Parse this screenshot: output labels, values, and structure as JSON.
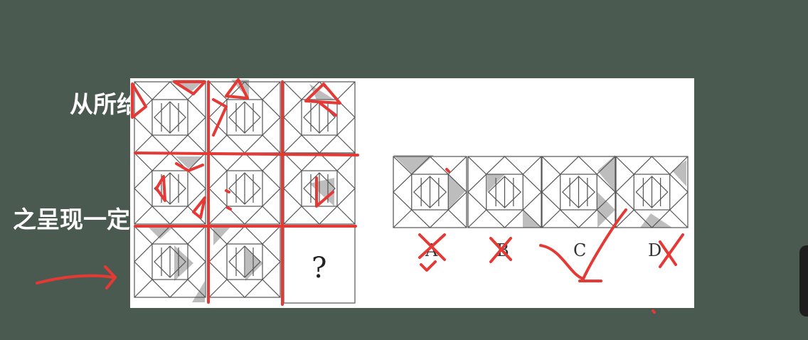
{
  "question": {
    "line1": "从所给的四个选项中，选择最合适的一个填入问号处，使",
    "line2": "之呈现一定的规律性："
  },
  "grid": {
    "missing_mark": "?"
  },
  "options": {
    "labels": [
      "A",
      "B",
      "C",
      "D"
    ]
  },
  "colors": {
    "background": "#4a5a51",
    "annotation": "#e53935",
    "shade": "#bdbdbd"
  }
}
